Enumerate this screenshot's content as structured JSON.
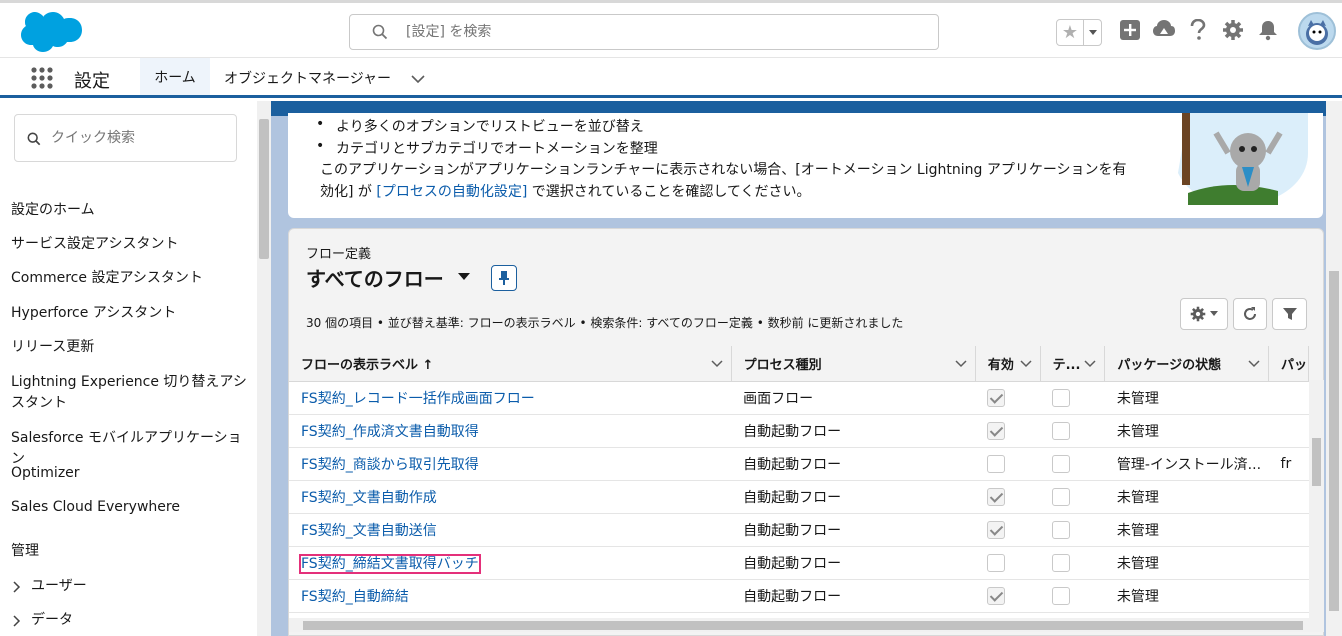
{
  "header": {
    "search_placeholder": "[設定] を検索",
    "icons": [
      "favorites-star-icon",
      "add-icon",
      "trailhead-icon",
      "help-icon",
      "setup-gear-icon",
      "notification-bell-icon",
      "user-avatar"
    ]
  },
  "nav": {
    "app_name": "設定",
    "tabs": [
      {
        "label": "ホーム",
        "active": true
      },
      {
        "label": "オブジェクトマネージャー",
        "active": false
      }
    ]
  },
  "sidebar": {
    "quick_find_placeholder": "クイック検索",
    "items": [
      {
        "label": "設定のホーム"
      },
      {
        "label": "サービス設定アシスタント"
      },
      {
        "label": "Commerce 設定アシスタント"
      },
      {
        "label": "Hyperforce アシスタント"
      },
      {
        "label": "リリース更新"
      },
      {
        "label": "Lightning Experience 切り替えアシスタント"
      },
      {
        "label": "Salesforce モバイルアプリケーション"
      },
      {
        "label": "Optimizer"
      },
      {
        "label": "Sales Cloud Everywhere"
      }
    ],
    "section_heading": "管理",
    "expandable": [
      {
        "label": "ユーザー"
      },
      {
        "label": "データ"
      }
    ]
  },
  "info": {
    "bullets": [
      "より多くのオプションでリストビューを並び替え",
      "カテゴリとサブカテゴリでオートメーションを整理"
    ],
    "text_part1": "このアプリケーションがアプリケーションランチャーに表示されない場合、[オートメーション Lightning アプリケーションを有効化] が ",
    "link": "[プロセスの自動化設定]",
    "text_part2": " で選択されていることを確認してください。"
  },
  "list": {
    "object_label": "フロー定義",
    "view_name": "すべてのフロー",
    "summary": "30 個の項目 • 並び替え基準: フローの表示ラベル • 検索条件: すべてのフロー定義 • 数秒前 に更新されました",
    "columns": [
      "フローの表示ラベル ↑",
      "プロセス種別",
      "有効",
      "テ...",
      "パッケージの状態",
      "パッ"
    ],
    "rows": [
      {
        "label": "FS契約_レコード一括作成画面フロー",
        "type": "画面フロー",
        "active": true,
        "test": false,
        "package": "未管理",
        "extra": ""
      },
      {
        "label": "FS契約_作成済文書自動取得",
        "type": "自動起動フロー",
        "active": true,
        "test": false,
        "package": "未管理",
        "extra": ""
      },
      {
        "label": "FS契約_商談から取引先取得",
        "type": "自動起動フロー",
        "active": false,
        "test": false,
        "package": "管理-インストール済...",
        "extra": "fr"
      },
      {
        "label": "FS契約_文書自動作成",
        "type": "自動起動フロー",
        "active": true,
        "test": false,
        "package": "未管理",
        "extra": ""
      },
      {
        "label": "FS契約_文書自動送信",
        "type": "自動起動フロー",
        "active": true,
        "test": false,
        "package": "未管理",
        "extra": ""
      },
      {
        "label": "FS契約_締結文書取得バッチ",
        "type": "自動起動フロー",
        "active": false,
        "test": false,
        "package": "未管理",
        "extra": "",
        "highlighted": true
      },
      {
        "label": "FS契約_自動締結",
        "type": "自動起動フロー",
        "active": true,
        "test": false,
        "package": "未管理",
        "extra": ""
      }
    ]
  },
  "colors": {
    "brand_blue": "#1b5f9e",
    "link_blue": "#0b5cab",
    "highlight_pink": "#e4307a",
    "salesforce_cloud": "#00a1e0"
  }
}
